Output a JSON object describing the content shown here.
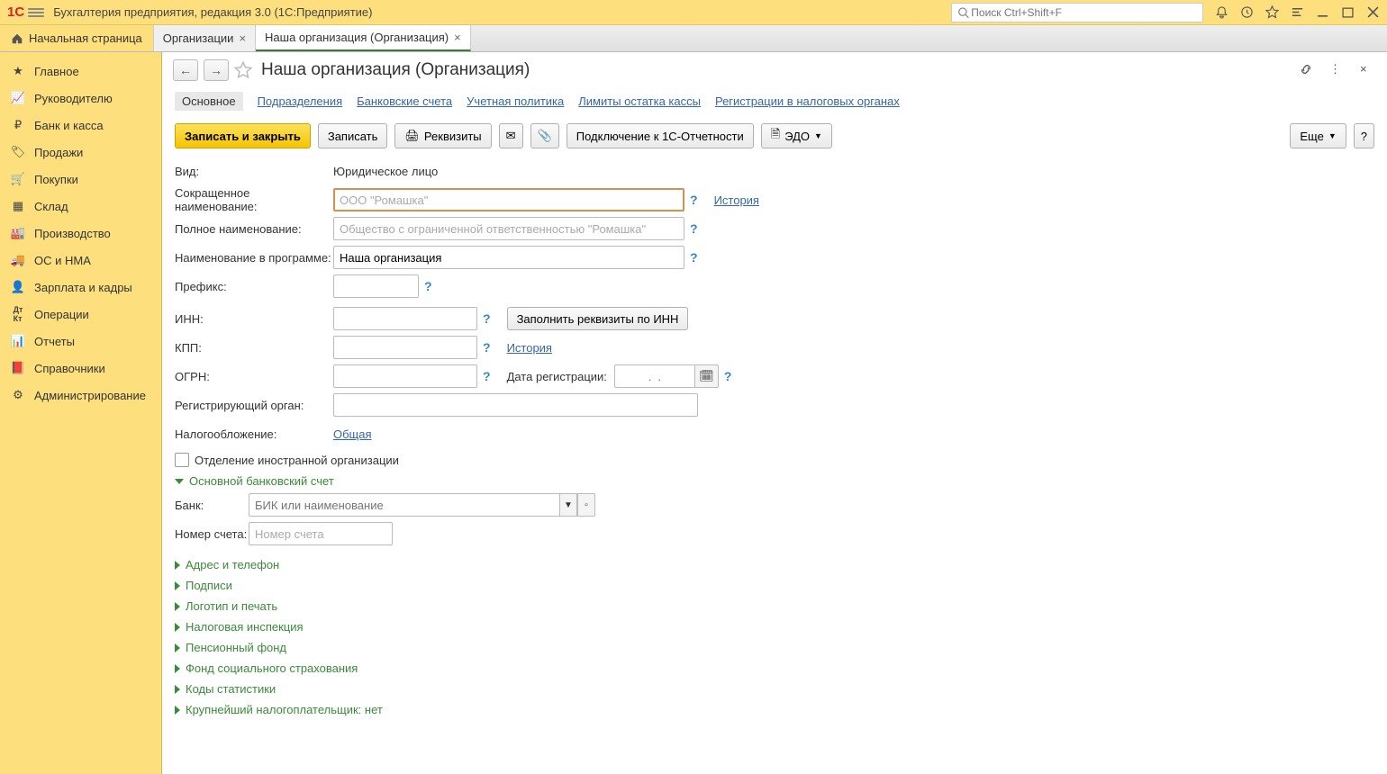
{
  "titlebar": {
    "logo": "1C",
    "title": "Бухгалтерия предприятия, редакция 3.0  (1С:Предприятие)",
    "search_placeholder": "Поиск Ctrl+Shift+F"
  },
  "tabs": {
    "home": "Начальная страница",
    "items": [
      {
        "label": "Организации",
        "active": false
      },
      {
        "label": "Наша организация (Организация)",
        "active": true
      }
    ]
  },
  "sidebar": [
    {
      "icon": "star",
      "label": "Главное"
    },
    {
      "icon": "chart",
      "label": "Руководителю"
    },
    {
      "icon": "ruble",
      "label": "Банк и касса"
    },
    {
      "icon": "tag",
      "label": "Продажи"
    },
    {
      "icon": "cart",
      "label": "Покупки"
    },
    {
      "icon": "boxes",
      "label": "Склад"
    },
    {
      "icon": "factory",
      "label": "Производство"
    },
    {
      "icon": "truck",
      "label": "ОС и НМА"
    },
    {
      "icon": "person",
      "label": "Зарплата и кадры"
    },
    {
      "icon": "dtkt",
      "label": "Операции"
    },
    {
      "icon": "bars",
      "label": "Отчеты"
    },
    {
      "icon": "book",
      "label": "Справочники"
    },
    {
      "icon": "gear",
      "label": "Администрирование"
    }
  ],
  "page": {
    "title": "Наша организация (Организация)",
    "subtabs": [
      "Основное",
      "Подразделения",
      "Банковские счета",
      "Учетная политика",
      "Лимиты остатка кассы",
      "Регистрации в налоговых органах"
    ],
    "toolbar": {
      "save_close": "Записать и закрыть",
      "save": "Записать",
      "details": "Реквизиты",
      "connect_1c": "Подключение к 1С-Отчетности",
      "edo": "ЭДО",
      "more": "Еще",
      "help": "?"
    },
    "form": {
      "kind_label": "Вид:",
      "kind_value": "Юридическое лицо",
      "short_name_label": "Сокращенное наименование:",
      "short_name_placeholder": "ООО \"Ромашка\"",
      "history_link": "История",
      "full_name_label": "Полное наименование:",
      "full_name_placeholder": "Общество с ограниченной ответственностью \"Ромашка\"",
      "prog_name_label": "Наименование в программе:",
      "prog_name_value": "Наша организация",
      "prefix_label": "Префикс:",
      "inn_label": "ИНН:",
      "fill_by_inn": "Заполнить реквизиты по ИНН",
      "kpp_label": "КПП:",
      "kpp_history": "История",
      "ogrn_label": "ОГРН:",
      "reg_date_label": "Дата регистрации:",
      "reg_date_placeholder": ".  .",
      "reg_body_label": "Регистрирующий орган:",
      "tax_label": "Налогообложение:",
      "tax_value": "Общая",
      "foreign_branch": "Отделение иностранной организации",
      "bank_section": "Основной банковский счет",
      "bank_label": "Банк:",
      "bank_placeholder": "БИК или наименование",
      "account_label": "Номер счета:",
      "account_placeholder": "Номер счета",
      "sections": [
        "Адрес и телефон",
        "Подписи",
        "Логотип и печать",
        "Налоговая инспекция",
        "Пенсионный фонд",
        "Фонд социального страхования",
        "Коды статистики",
        "Крупнейший налогоплательщик: нет"
      ]
    }
  }
}
